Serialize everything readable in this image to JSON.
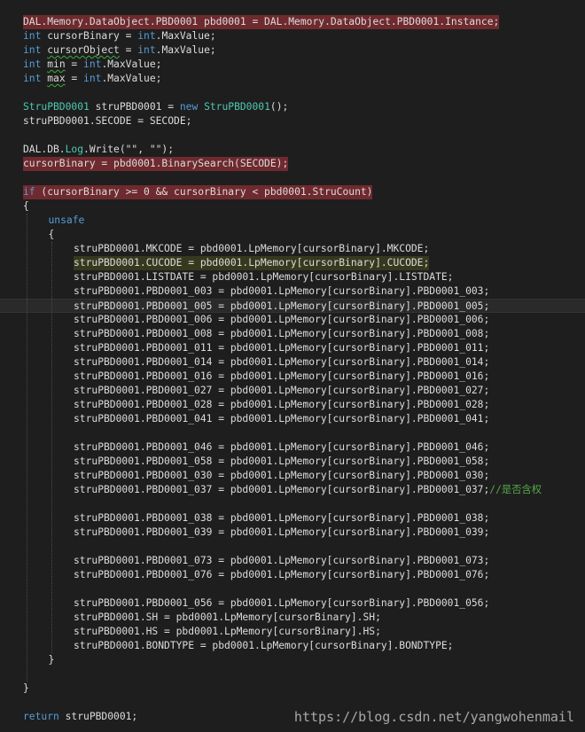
{
  "lines": [
    {
      "indent": 0,
      "highlight": "red",
      "tokens": [
        [
          "DAL.Memory.DataObject.PBD0001 pbd0001 = DAL.Memory.DataObject.PBD0001.Instance;",
          ""
        ]
      ]
    },
    {
      "indent": 0,
      "tokens": [
        [
          "int",
          "kw"
        ],
        [
          " cursorBinary = ",
          ""
        ],
        [
          "int",
          "kw"
        ],
        [
          ".MaxValue;",
          ""
        ]
      ]
    },
    {
      "indent": 0,
      "tokens": [
        [
          "int",
          "kw"
        ],
        [
          " ",
          ""
        ],
        [
          "cursorObject",
          "squig"
        ],
        [
          " = ",
          ""
        ],
        [
          "int",
          "kw"
        ],
        [
          ".MaxValue;",
          ""
        ]
      ]
    },
    {
      "indent": 0,
      "tokens": [
        [
          "int",
          "kw"
        ],
        [
          " ",
          ""
        ],
        [
          "min",
          "squig"
        ],
        [
          " = ",
          ""
        ],
        [
          "int",
          "kw"
        ],
        [
          ".MaxValue;",
          ""
        ]
      ]
    },
    {
      "indent": 0,
      "tokens": [
        [
          "int",
          "kw"
        ],
        [
          " ",
          ""
        ],
        [
          "max",
          "squig"
        ],
        [
          " = ",
          ""
        ],
        [
          "int",
          "kw"
        ],
        [
          ".MaxValue;",
          ""
        ]
      ]
    },
    {
      "indent": 0,
      "tokens": []
    },
    {
      "indent": 0,
      "tokens": [
        [
          "StruPBD0001",
          "ty"
        ],
        [
          " struPBD0001 = ",
          ""
        ],
        [
          "new",
          "kw"
        ],
        [
          " ",
          ""
        ],
        [
          "StruPBD0001",
          "ty"
        ],
        [
          "();",
          ""
        ]
      ]
    },
    {
      "indent": 0,
      "tokens": [
        [
          "struPBD0001.SECODE = SECODE;",
          ""
        ]
      ]
    },
    {
      "indent": 0,
      "tokens": []
    },
    {
      "indent": 0,
      "tokens": [
        [
          "DAL.DB.",
          ""
        ],
        [
          "Log",
          "ty"
        ],
        [
          ".Write(\"\", \"\");",
          ""
        ]
      ]
    },
    {
      "indent": 0,
      "highlight": "red",
      "tokens": [
        [
          "cursorBinary = pbd0001.BinarySearch(SECODE);",
          ""
        ]
      ]
    },
    {
      "indent": 0,
      "tokens": []
    },
    {
      "indent": 0,
      "highlight": "red",
      "tokens": [
        [
          "if",
          "kw"
        ],
        [
          " (cursorBinary >= 0 && cursorBinary < pbd0001.StruCount)",
          ""
        ]
      ]
    },
    {
      "indent": 0,
      "tokens": [
        [
          "{",
          ""
        ]
      ]
    },
    {
      "indent": 1,
      "tokens": [
        [
          "unsafe",
          "kw"
        ]
      ]
    },
    {
      "indent": 1,
      "tokens": [
        [
          "{",
          ""
        ]
      ]
    },
    {
      "indent": 2,
      "tokens": [
        [
          "struPBD0001.MKCODE = pbd0001.LpMemory[cursorBinary].MKCODE;",
          ""
        ]
      ]
    },
    {
      "indent": 2,
      "highlight": "yellow",
      "tokens": [
        [
          "struPBD0001.CUCODE = pbd0001.LpMemory[cursorBinary].CUCODE;",
          ""
        ]
      ]
    },
    {
      "indent": 2,
      "tokens": [
        [
          "struPBD0001.LISTDATE = pbd0001.LpMemory[cursorBinary].LISTDATE;",
          ""
        ]
      ]
    },
    {
      "indent": 2,
      "tokens": [
        [
          "struPBD0001.PBD0001_003 = pbd0001.LpMemory[cursorBinary].PBD0001_003;",
          ""
        ]
      ]
    },
    {
      "indent": 2,
      "current": true,
      "tokens": [
        [
          "struPBD0001.PBD0001_005 = pbd0001.LpMemory[cursorBinary].PBD0001_005;",
          ""
        ]
      ]
    },
    {
      "indent": 2,
      "tokens": [
        [
          "struPBD0001.PBD0001_006 = pbd0001.LpMemory[cursorBinary].PBD0001_006;",
          ""
        ]
      ]
    },
    {
      "indent": 2,
      "tokens": [
        [
          "struPBD0001.PBD0001_008 = pbd0001.LpMemory[cursorBinary].PBD0001_008;",
          ""
        ]
      ]
    },
    {
      "indent": 2,
      "tokens": [
        [
          "struPBD0001.PBD0001_011 = pbd0001.LpMemory[cursorBinary].PBD0001_011;",
          ""
        ]
      ]
    },
    {
      "indent": 2,
      "tokens": [
        [
          "struPBD0001.PBD0001_014 = pbd0001.LpMemory[cursorBinary].PBD0001_014;",
          ""
        ]
      ]
    },
    {
      "indent": 2,
      "tokens": [
        [
          "struPBD0001.PBD0001_016 = pbd0001.LpMemory[cursorBinary].PBD0001_016;",
          ""
        ]
      ]
    },
    {
      "indent": 2,
      "tokens": [
        [
          "struPBD0001.PBD0001_027 = pbd0001.LpMemory[cursorBinary].PBD0001_027;",
          ""
        ]
      ]
    },
    {
      "indent": 2,
      "tokens": [
        [
          "struPBD0001.PBD0001_028 = pbd0001.LpMemory[cursorBinary].PBD0001_028;",
          ""
        ]
      ]
    },
    {
      "indent": 2,
      "tokens": [
        [
          "struPBD0001.PBD0001_041 = pbd0001.LpMemory[cursorBinary].PBD0001_041;",
          ""
        ]
      ]
    },
    {
      "indent": 2,
      "tokens": []
    },
    {
      "indent": 2,
      "tokens": [
        [
          "struPBD0001.PBD0001_046 = pbd0001.LpMemory[cursorBinary].PBD0001_046;",
          ""
        ]
      ]
    },
    {
      "indent": 2,
      "tokens": [
        [
          "struPBD0001.PBD0001_058 = pbd0001.LpMemory[cursorBinary].PBD0001_058;",
          ""
        ]
      ]
    },
    {
      "indent": 2,
      "tokens": [
        [
          "struPBD0001.PBD0001_030 = pbd0001.LpMemory[cursorBinary].PBD0001_030;",
          ""
        ]
      ]
    },
    {
      "indent": 2,
      "tokens": [
        [
          "struPBD0001.PBD0001_037 = pbd0001.LpMemory[cursorBinary].PBD0001_037;",
          ""
        ],
        [
          "//是否含权",
          "cm"
        ]
      ]
    },
    {
      "indent": 2,
      "tokens": []
    },
    {
      "indent": 2,
      "tokens": [
        [
          "struPBD0001.PBD0001_038 = pbd0001.LpMemory[cursorBinary].PBD0001_038;",
          ""
        ]
      ]
    },
    {
      "indent": 2,
      "tokens": [
        [
          "struPBD0001.PBD0001_039 = pbd0001.LpMemory[cursorBinary].PBD0001_039;",
          ""
        ]
      ]
    },
    {
      "indent": 2,
      "tokens": []
    },
    {
      "indent": 2,
      "tokens": [
        [
          "struPBD0001.PBD0001_073 = pbd0001.LpMemory[cursorBinary].PBD0001_073;",
          ""
        ]
      ]
    },
    {
      "indent": 2,
      "tokens": [
        [
          "struPBD0001.PBD0001_076 = pbd0001.LpMemory[cursorBinary].PBD0001_076;",
          ""
        ]
      ]
    },
    {
      "indent": 2,
      "tokens": []
    },
    {
      "indent": 2,
      "tokens": [
        [
          "struPBD0001.PBD0001_056 = pbd0001.LpMemory[cursorBinary].PBD0001_056;",
          ""
        ]
      ]
    },
    {
      "indent": 2,
      "tokens": [
        [
          "struPBD0001.SH = pbd0001.LpMemory[cursorBinary].SH;",
          ""
        ]
      ]
    },
    {
      "indent": 2,
      "tokens": [
        [
          "struPBD0001.HS = pbd0001.LpMemory[cursorBinary].HS;",
          ""
        ]
      ]
    },
    {
      "indent": 2,
      "tokens": [
        [
          "struPBD0001.BONDTYPE = pbd0001.LpMemory[cursorBinary].BONDTYPE;",
          ""
        ]
      ]
    },
    {
      "indent": 1,
      "tokens": [
        [
          "}",
          ""
        ]
      ]
    },
    {
      "indent": 0,
      "tokens": []
    },
    {
      "indent": 0,
      "tokens": [
        [
          "}",
          ""
        ]
      ]
    },
    {
      "indent": 0,
      "tokens": []
    },
    {
      "indent": 0,
      "tokens": [
        [
          "return",
          "kw"
        ],
        [
          " struPBD0001;",
          ""
        ]
      ]
    }
  ],
  "watermark": "https://blog.csdn.net/yangwohenmail",
  "colors": {
    "background": "#1e1e1e",
    "text": "#dcdcdc",
    "keyword": "#569cd6",
    "type": "#4ec9b0",
    "comment": "#57a64a",
    "highlight_red": "#6e2a2e",
    "highlight_yellow": "#37391f"
  }
}
